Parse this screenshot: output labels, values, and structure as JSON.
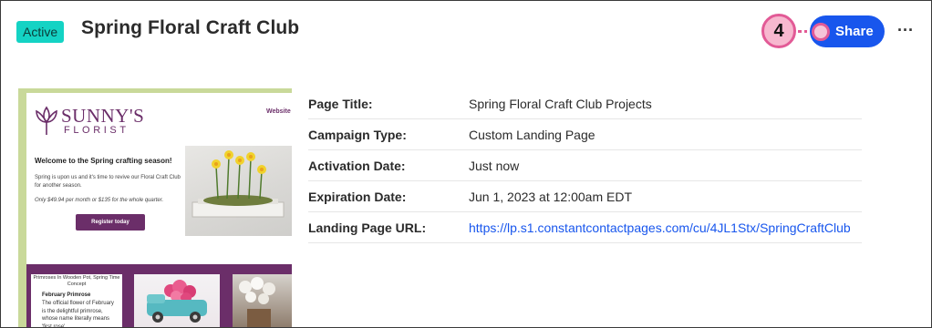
{
  "header": {
    "status_badge": "Active",
    "title": "Spring Floral Craft Club",
    "step_number": "4",
    "share_label": "Share",
    "more_label": "···"
  },
  "preview": {
    "logo_main": "SUNNY'S",
    "logo_sub": "FLORIST",
    "nav_link": "Website",
    "welcome": "Welcome to the Spring crafting season!",
    "paragraph": "Spring is upon us and it's time to revive our Floral Craft Club for another season.",
    "price_line": "Only $49.94 per month or $135 for the whole quarter.",
    "register_button": "Register today",
    "card_caption": "Primroses In Wooden Pot, Spring Time Concept",
    "card_heading": "February Primrose",
    "card_body": "The official flower of February is the delightful primrose, whose name literally means 'first rose'."
  },
  "details": [
    {
      "label": "Page Title:",
      "value": "Spring Floral Craft Club Projects",
      "is_link": false
    },
    {
      "label": "Campaign Type:",
      "value": "Custom Landing Page",
      "is_link": false
    },
    {
      "label": "Activation Date:",
      "value": "Just now",
      "is_link": false
    },
    {
      "label": "Expiration Date:",
      "value": "Jun 1, 2023 at 12:00am EDT",
      "is_link": false
    },
    {
      "label": "Landing Page URL:",
      "value": "https://lp.s1.constantcontactpages.com/cu/4JL1Stx/SpringCraftClub",
      "is_link": true
    }
  ],
  "colors": {
    "badge_bg": "#14d3c4",
    "share_bg": "#1856ed",
    "callout": "#e25a96",
    "brand_purple": "#6b2e69",
    "link": "#1856ed"
  }
}
